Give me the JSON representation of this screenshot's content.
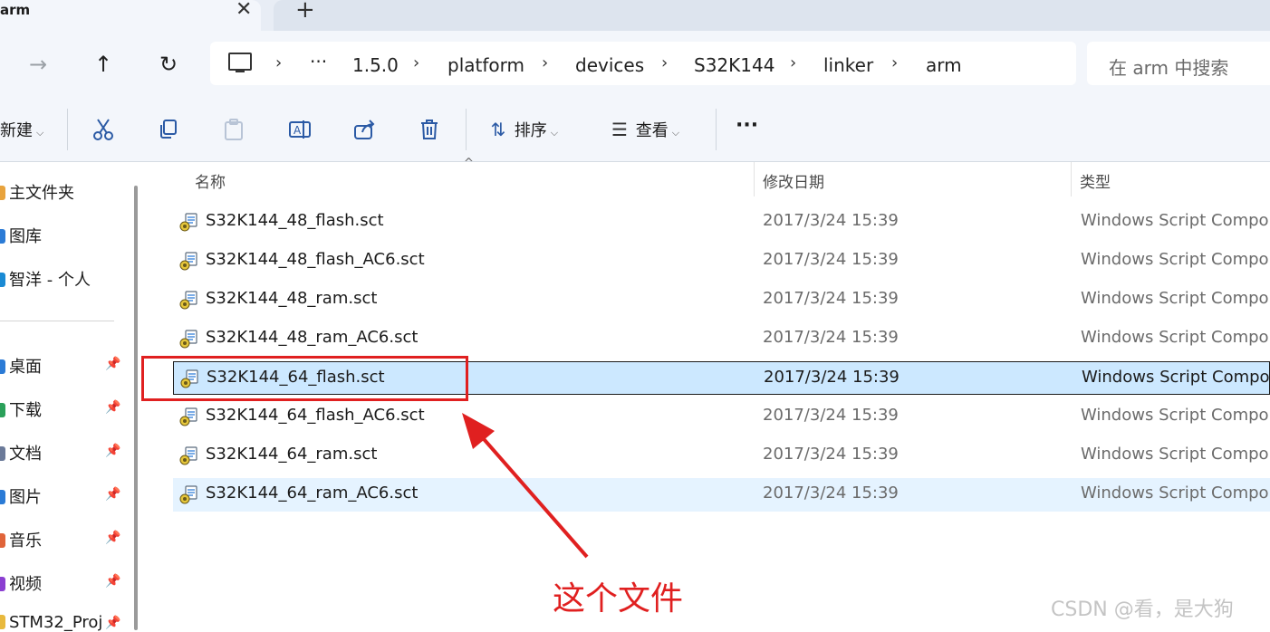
{
  "tab": {
    "title": "arm",
    "close": "✕",
    "new_tab": "+"
  },
  "nav": {
    "forward": "→",
    "up": "↑",
    "refresh": "↻"
  },
  "breadcrumb": {
    "more": "···",
    "items": [
      "1.5.0",
      "platform",
      "devices",
      "S32K144",
      "linker",
      "arm"
    ],
    "separator": "›"
  },
  "search": {
    "placeholder": "在 arm 中搜索"
  },
  "toolbar": {
    "new_label": "新建",
    "sort_label": "排序",
    "view_label": "查看",
    "more": "···"
  },
  "sidebar": {
    "items": [
      {
        "label": "主文件夹",
        "color": "#e8a33d"
      },
      {
        "label": "图库",
        "color": "#2b7bd6"
      },
      {
        "label": "智洋 - 个人",
        "color": "#1a8ad4"
      }
    ],
    "quick": [
      {
        "label": "桌面",
        "color": "#2b7bd6"
      },
      {
        "label": "下载",
        "color": "#2aa05a"
      },
      {
        "label": "文档",
        "color": "#6b7a99"
      },
      {
        "label": "图片",
        "color": "#2b7bd6"
      },
      {
        "label": "音乐",
        "color": "#e0643a"
      },
      {
        "label": "视频",
        "color": "#8b3fd1"
      },
      {
        "label": "STM32_Proj",
        "color": "#e8b93d"
      }
    ]
  },
  "columns": {
    "name": "名称",
    "date": "修改日期",
    "type": "类型"
  },
  "files": [
    {
      "name": "S32K144_48_flash.sct",
      "date": "2017/3/24 15:39",
      "type": "Windows Script Compor",
      "state": ""
    },
    {
      "name": "S32K144_48_flash_AC6.sct",
      "date": "2017/3/24 15:39",
      "type": "Windows Script Compor",
      "state": ""
    },
    {
      "name": "S32K144_48_ram.sct",
      "date": "2017/3/24 15:39",
      "type": "Windows Script Compor",
      "state": ""
    },
    {
      "name": "S32K144_48_ram_AC6.sct",
      "date": "2017/3/24 15:39",
      "type": "Windows Script Compor",
      "state": ""
    },
    {
      "name": "S32K144_64_flash.sct",
      "date": "2017/3/24 15:39",
      "type": "Windows Script Compor",
      "state": "selected"
    },
    {
      "name": "S32K144_64_flash_AC6.sct",
      "date": "2017/3/24 15:39",
      "type": "Windows Script Compor",
      "state": ""
    },
    {
      "name": "S32K144_64_ram.sct",
      "date": "2017/3/24 15:39",
      "type": "Windows Script Compor",
      "state": ""
    },
    {
      "name": "S32K144_64_ram_AC6.sct",
      "date": "2017/3/24 15:39",
      "type": "Windows Script Compor",
      "state": "hover"
    }
  ],
  "annotation": {
    "text": "这个文件",
    "color": "#e02020"
  },
  "watermark": "CSDN @看，是大狗"
}
